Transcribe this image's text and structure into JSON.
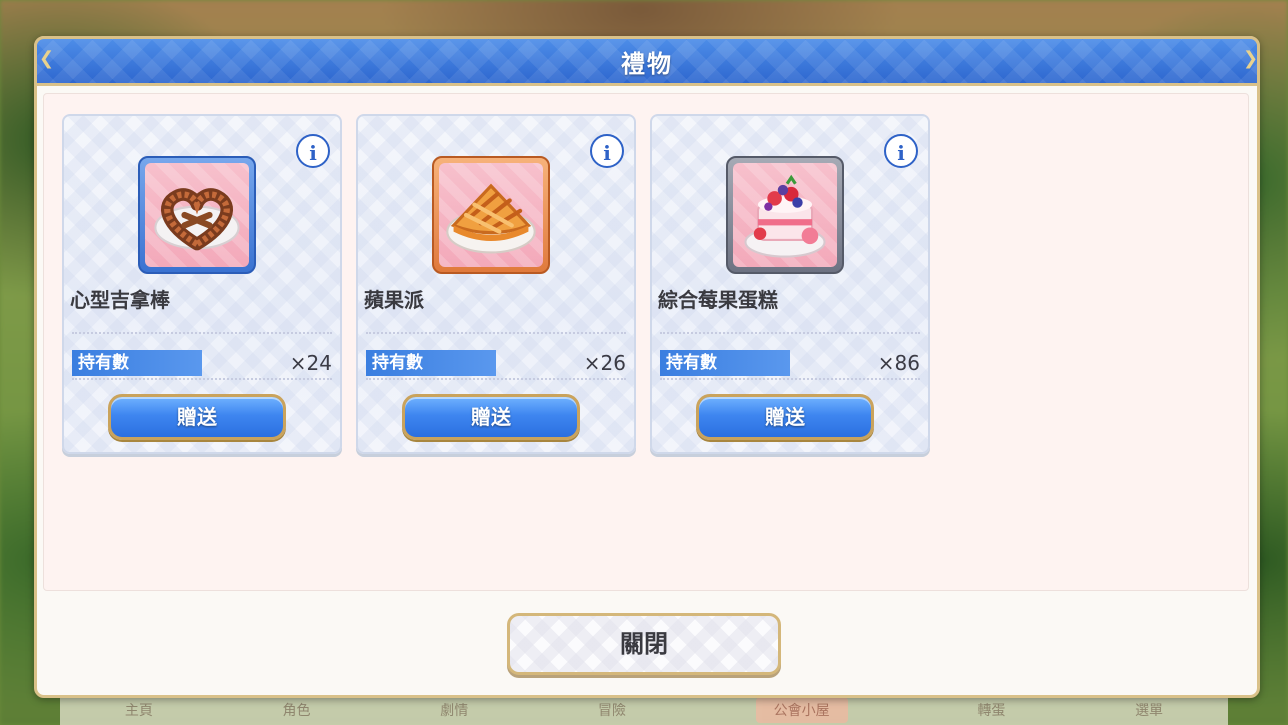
{
  "dialog": {
    "title": "禮物",
    "close_label": "關閉"
  },
  "items": [
    {
      "name": "心型吉拿棒",
      "owned_label": "持有數",
      "count": "×24",
      "gift_label": "贈送",
      "info_label": "i",
      "icon": "heart-churro-icon",
      "frame_color": "#3a72d1"
    },
    {
      "name": "蘋果派",
      "owned_label": "持有數",
      "count": "×26",
      "gift_label": "贈送",
      "info_label": "i",
      "icon": "apple-pie-icon",
      "frame_color": "#e07a3c"
    },
    {
      "name": "綜合莓果蛋糕",
      "owned_label": "持有數",
      "count": "×86",
      "gift_label": "贈送",
      "info_label": "i",
      "icon": "berry-cake-icon",
      "frame_color": "#6d7282"
    }
  ],
  "background_nav": {
    "items": [
      "主頁",
      "角色",
      "劇情",
      "冒險",
      "公會小屋",
      "轉蛋",
      "選單"
    ]
  },
  "colors": {
    "header_blue": "#2e67cf",
    "button_blue": "#3e86f0",
    "gold_border": "#d9c189",
    "content_bg": "#fef3f1"
  }
}
